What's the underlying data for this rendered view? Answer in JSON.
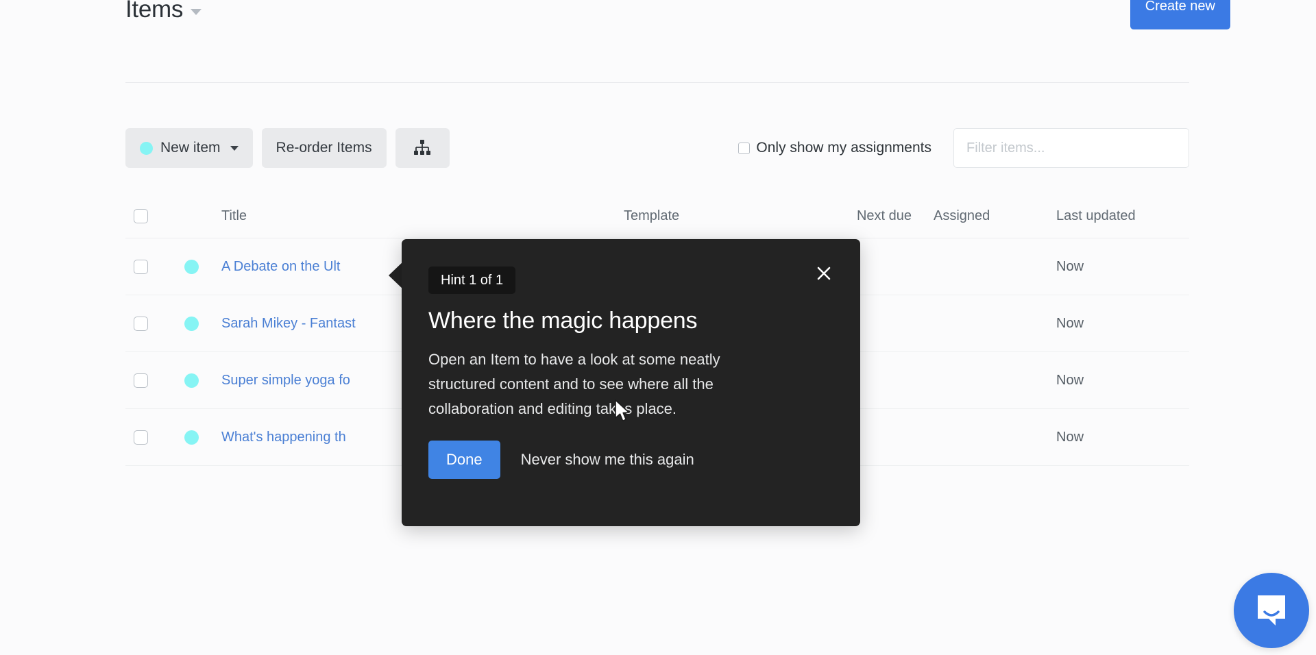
{
  "header": {
    "title": "Items",
    "title_caret_icon": "chevron-down-icon",
    "create_new_label": "Create new",
    "accent_blue": "#3b7ae4"
  },
  "toolbar": {
    "new_item_label": "New item",
    "new_item_dot_color": "#86f4f4",
    "new_item_caret_icon": "chevron-down-icon",
    "reorder_label": "Re-order Items",
    "hierarchy_icon": "sitemap-icon",
    "only_my_assignments_label": "Only show my assignments",
    "only_my_assignments_checked": false,
    "filter_placeholder": "Filter items...",
    "filter_value": ""
  },
  "table": {
    "columns": {
      "title": "Title",
      "template": "Template",
      "next_due": "Next due",
      "assigned": "Assigned",
      "last_updated": "Last updated"
    },
    "rows": [
      {
        "title": "A Debate on the Ult",
        "dot_color": "#86f4f4",
        "template": "",
        "next_due": "",
        "assigned": "",
        "last_updated": "Now",
        "checked": false
      },
      {
        "title": "Sarah Mikey - Fantast",
        "dot_color": "#86f4f4",
        "template": "",
        "next_due": "",
        "assigned": "",
        "last_updated": "Now",
        "checked": false
      },
      {
        "title": "Super simple yoga fo",
        "dot_color": "#86f4f4",
        "template": "",
        "next_due": "",
        "assigned": "",
        "last_updated": "Now",
        "checked": false
      },
      {
        "title": "What's happening th",
        "dot_color": "#86f4f4",
        "template": "",
        "next_due": "",
        "assigned": "",
        "last_updated": "Now",
        "checked": false
      }
    ]
  },
  "hint": {
    "badge": "Hint 1 of 1",
    "title": "Where the magic happens",
    "body": "Open an Item to have a look at some neatly structured content and to see where all the collaboration and editing takes place.",
    "done_label": "Done",
    "never_label": "Never show me this again",
    "close_icon": "close-icon",
    "background": "#232323",
    "done_color": "#4084e4"
  },
  "chat": {
    "launcher_icon": "chat-bubble-icon",
    "launcher_color": "#3b7ae4"
  }
}
